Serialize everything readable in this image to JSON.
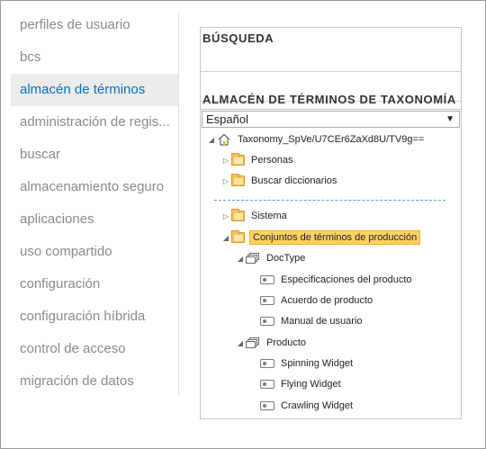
{
  "left_nav": {
    "items": [
      {
        "label": "perfiles de usuario",
        "active": false
      },
      {
        "label": "bcs",
        "active": false
      },
      {
        "label": "almacén de términos",
        "active": true
      },
      {
        "label": "administración de regis...",
        "active": false
      },
      {
        "label": "buscar",
        "active": false
      },
      {
        "label": "almacenamiento seguro",
        "active": false
      },
      {
        "label": "aplicaciones",
        "active": false
      },
      {
        "label": "uso compartido",
        "active": false
      },
      {
        "label": "configuración",
        "active": false
      },
      {
        "label": "configuración híbrida",
        "active": false
      },
      {
        "label": "control de acceso",
        "active": false
      },
      {
        "label": "migración de datos",
        "active": false
      }
    ]
  },
  "panel": {
    "search_heading": "BÚSQUEDA",
    "taxonomy_heading": "ALMACÉN DE TÉRMINOS DE TAXONOMÍA",
    "language_select": {
      "value": "Español",
      "arrow": "▼"
    }
  },
  "tree": {
    "root": {
      "label": "Taxonomy_SpVe/U7CEr6ZaXd8U/TV9g==",
      "toggle": "◢",
      "icon": "home-icon"
    },
    "groups": [
      {
        "label": "Personas",
        "toggle": "▷",
        "icon": "folder-icon"
      },
      {
        "label": "Buscar diccionarios",
        "toggle": "▷",
        "icon": "folder-icon"
      },
      {
        "label": "Sistema",
        "toggle": "▷",
        "icon": "folder-icon"
      },
      {
        "label": "Conjuntos de términos de producción",
        "toggle": "◢",
        "icon": "folder-icon",
        "selected": true
      }
    ],
    "term_sets": [
      {
        "label": "DocType",
        "toggle": "◢",
        "icon": "termset-icon",
        "terms": [
          "Especificaciones del producto",
          "Acuerdo de producto",
          "Manual de usuario"
        ]
      },
      {
        "label": "Producto",
        "toggle": "◢",
        "icon": "termset-icon",
        "terms": [
          "Spinning Widget",
          "Flying Widget",
          "Crawling Widget"
        ]
      }
    ]
  },
  "colors": {
    "active_link": "#0072c6",
    "nav_text": "#8a8a8a",
    "selected_fill": "#ffd163",
    "folder": "#f7c15b",
    "separator": "#5b9bd5"
  }
}
